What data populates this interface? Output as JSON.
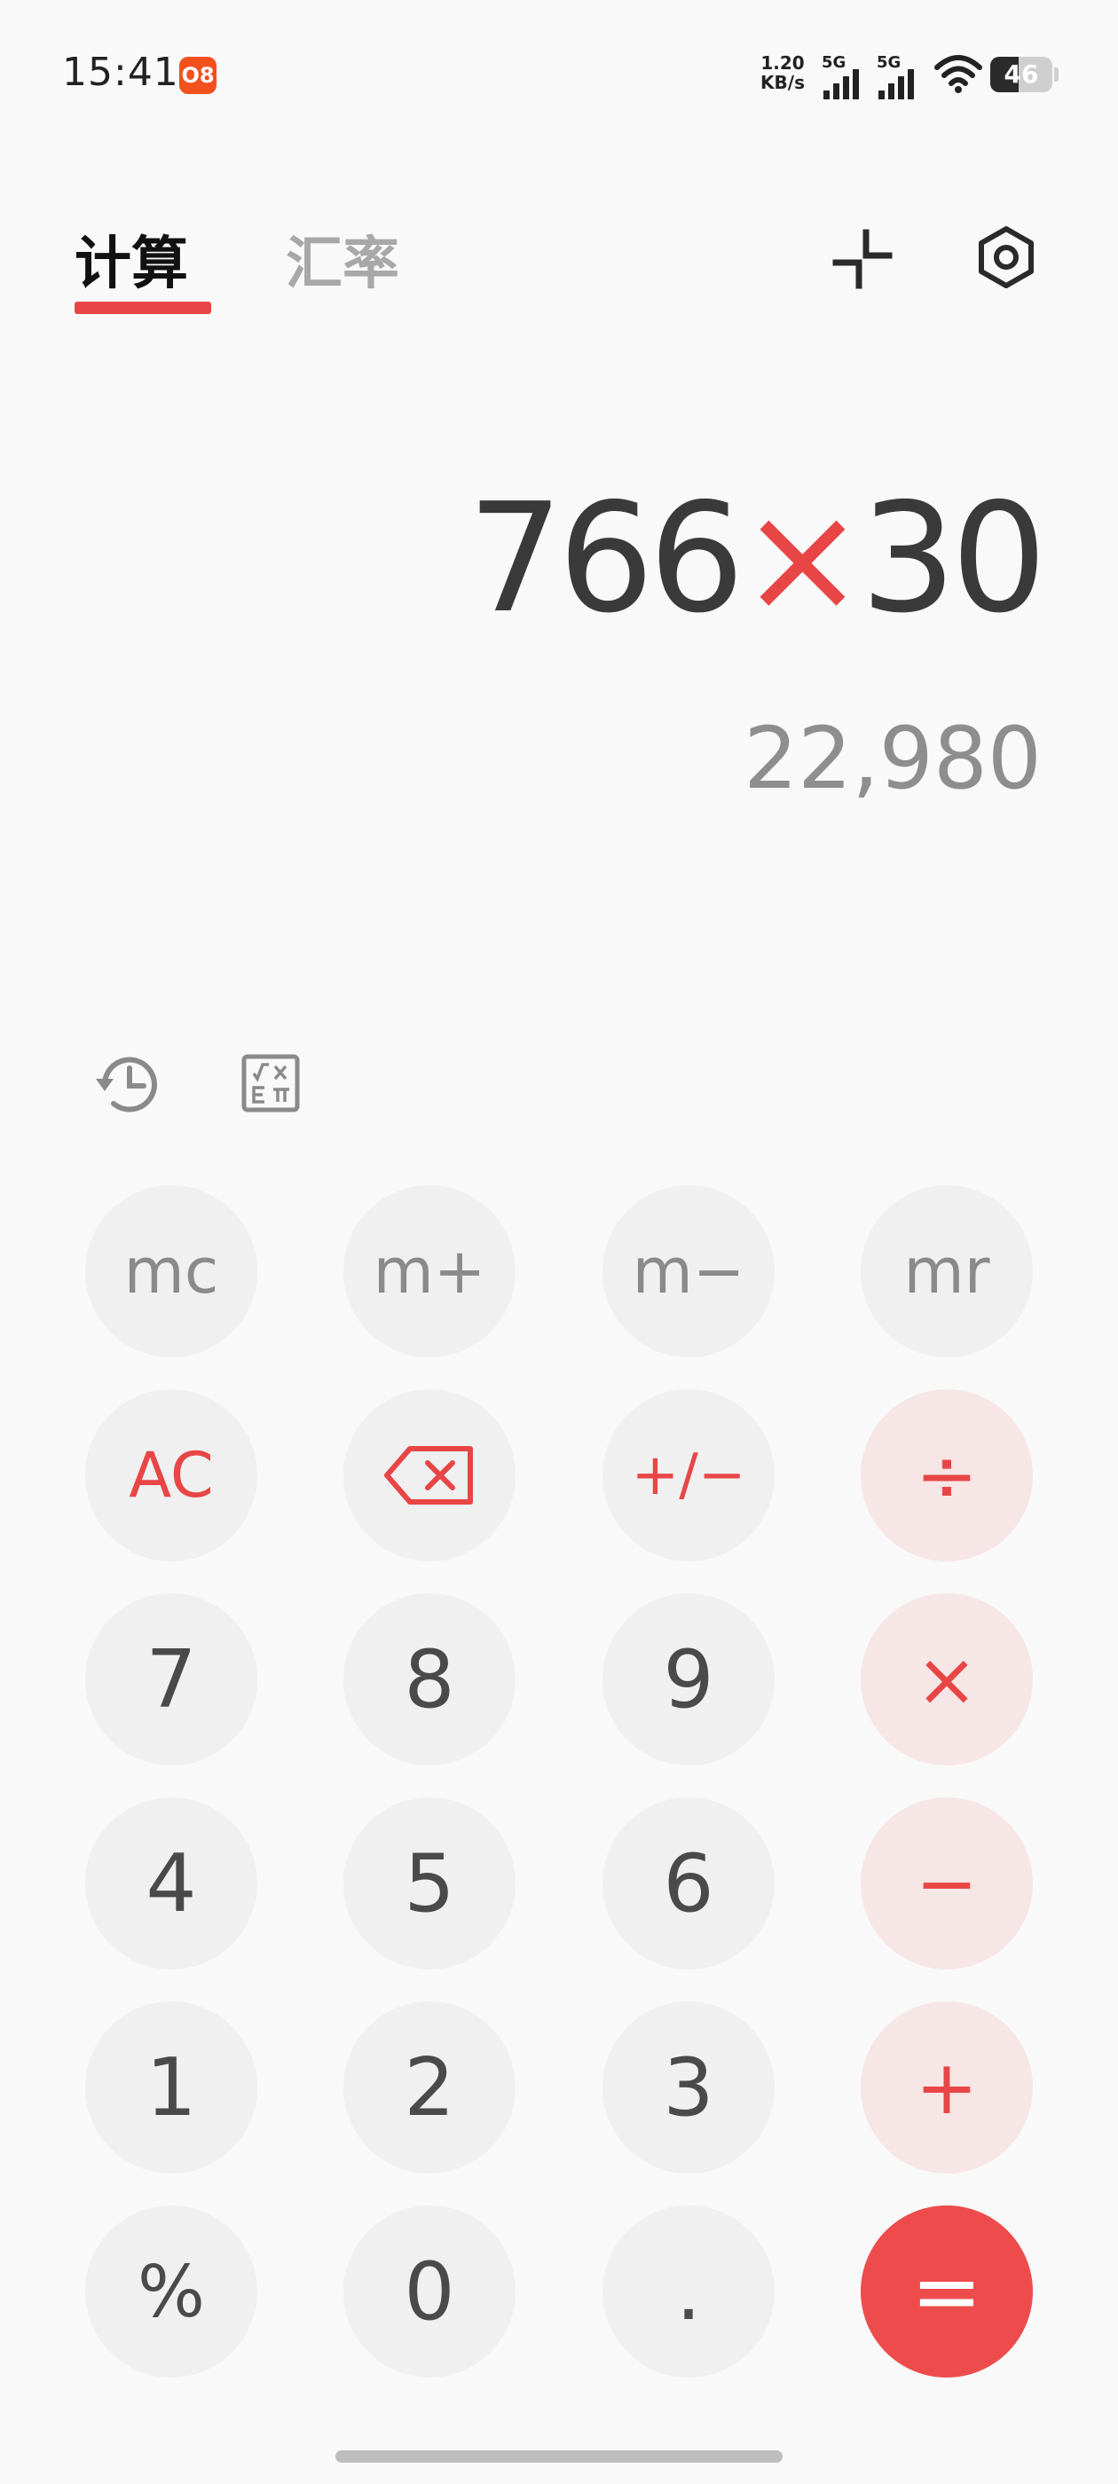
{
  "status": {
    "time": "15:41",
    "net_speed_value": "1.20",
    "net_speed_unit": "KB/s",
    "sim1_label": "5G",
    "sim2_label": "5G",
    "battery_level": 46,
    "battery_text": "46",
    "app_badge": "O8"
  },
  "tabs": {
    "calc_label": "计算",
    "rate_label": "汇率",
    "active": "calc"
  },
  "display": {
    "operand1": "766",
    "operator": "×",
    "operand2": "30",
    "result": "22,980"
  },
  "keys": {
    "mc": "mc",
    "mplus": "m+",
    "mminus": "m−",
    "mr": "mr",
    "ac": "AC",
    "plusminus": "+/−",
    "divide": "÷",
    "seven": "7",
    "eight": "8",
    "nine": "9",
    "multiply": "×",
    "four": "4",
    "five": "5",
    "six": "6",
    "minus": "−",
    "one": "1",
    "two": "2",
    "three": "3",
    "plus": "+",
    "percent": "%",
    "zero": "0",
    "dot": ".",
    "equals": "="
  },
  "icons": {
    "collapse": "collapse-icon",
    "settings": "settings-icon",
    "history": "history-icon",
    "scientific": "scientific-icon",
    "backspace": "backspace-icon"
  },
  "colors": {
    "accent": "#e84646",
    "operator_bg": "#f7e6e6",
    "key_bg": "#f0f0f0"
  }
}
